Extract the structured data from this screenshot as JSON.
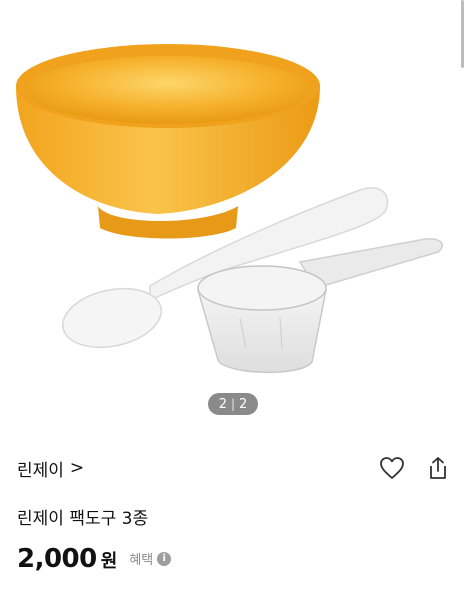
{
  "product": {
    "image_counter": {
      "current": "2",
      "separator": "|",
      "total": "2"
    },
    "brand": "린제이",
    "brand_chevron": ">",
    "title": "린제이 팩도구 3종",
    "price": "2,000",
    "currency": "원",
    "benefit_label": "혜택",
    "benefit_info_glyph": "i"
  },
  "icons": {
    "wishlist": "heart-icon",
    "share": "share-icon",
    "brand_link": "chevron-right-icon",
    "benefit_info": "info-icon"
  },
  "colors": {
    "bowl": "#F3A823",
    "bowl_highlight": "#FBC84B",
    "pager_bg": "#8A8A8A",
    "text": "#111111",
    "muted": "#8C8C8C"
  }
}
